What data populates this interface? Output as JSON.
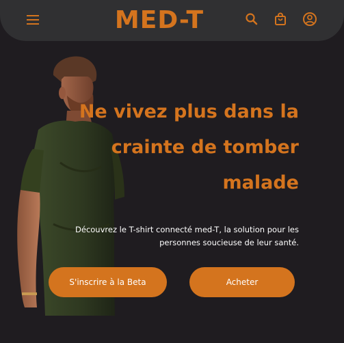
{
  "header": {
    "brand": "MED-T",
    "icons": [
      "menu-icon",
      "search-icon",
      "shopping-bag-icon",
      "account-icon"
    ]
  },
  "hero": {
    "headline_line1": "Ne vivez plus dans la",
    "headline_line2": "crainte de tomber",
    "headline_line3": "malade",
    "subtitle_line1": "Découvrez le T-shirt connecté med-T, la solution pour les",
    "subtitle_line2": "personnes soucieuse de leur santé.",
    "primary_button": "S'inscrire à la Beta",
    "secondary_button": "Acheter"
  },
  "colors": {
    "accent": "#d4741e",
    "background": "#1f1c20",
    "header": "#303032",
    "text": "#ffffff"
  }
}
